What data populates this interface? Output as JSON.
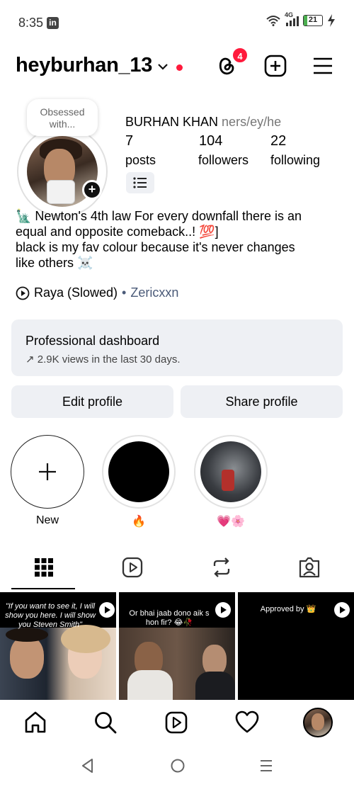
{
  "status_bar": {
    "time": "8:35",
    "app_icon": "in",
    "network": "4G",
    "battery": "21"
  },
  "header": {
    "username": "heyburhan_13",
    "threads_badge": "4"
  },
  "profile": {
    "note": "Obsessed with...",
    "full_name": "BURHAN KHAN",
    "pronouns": "ners/ey/he",
    "stats": [
      {
        "value": "7",
        "label": "posts"
      },
      {
        "value": "104",
        "label": "followers"
      },
      {
        "value": "22",
        "label": "following"
      }
    ]
  },
  "bio": {
    "lines": [
      "🗽 Newton's 4th law  For every downfall there is an",
      "equal and opposite comeback..! 💯]",
      "black is my fav colour because it's never changes",
      "like others ☠️"
    ]
  },
  "music": {
    "song": "Raya (Slowed)",
    "separator": "•",
    "artist": "Zericxxn"
  },
  "dashboard": {
    "title": "Professional dashboard",
    "subtitle": "↗ 2.9K views in the last 30 days."
  },
  "buttons": {
    "edit": "Edit profile",
    "share": "Share profile"
  },
  "highlights": [
    {
      "label": "New"
    },
    {
      "label": "🔥"
    },
    {
      "label": "💗🌸"
    }
  ],
  "posts": [
    {
      "caption": "\"If you want to see it, I will show you here. I will show you Steven Smith\""
    },
    {
      "caption": "Or bhai jaab dono aik s hon fir? 😂🥀"
    },
    {
      "caption": "Approved by 👑"
    }
  ],
  "icons": {
    "status": [
      "wifi-icon",
      "signal-icon",
      "battery-icon",
      "charging-icon"
    ],
    "header": [
      "chevron-down-icon",
      "threads-icon",
      "create-post-icon",
      "menu-icon"
    ],
    "tabs": [
      "grid-icon",
      "reels-icon",
      "reposts-icon",
      "tagged-icon"
    ],
    "bottom_nav": [
      "home-icon",
      "search-icon",
      "reels-icon",
      "heart-icon",
      "profile-avatar"
    ]
  },
  "colors": {
    "live_dot": "#ff1a3c",
    "badge": "#ff1a3c",
    "surface": "#eef0f4",
    "link_muted": "#4a5a78"
  }
}
